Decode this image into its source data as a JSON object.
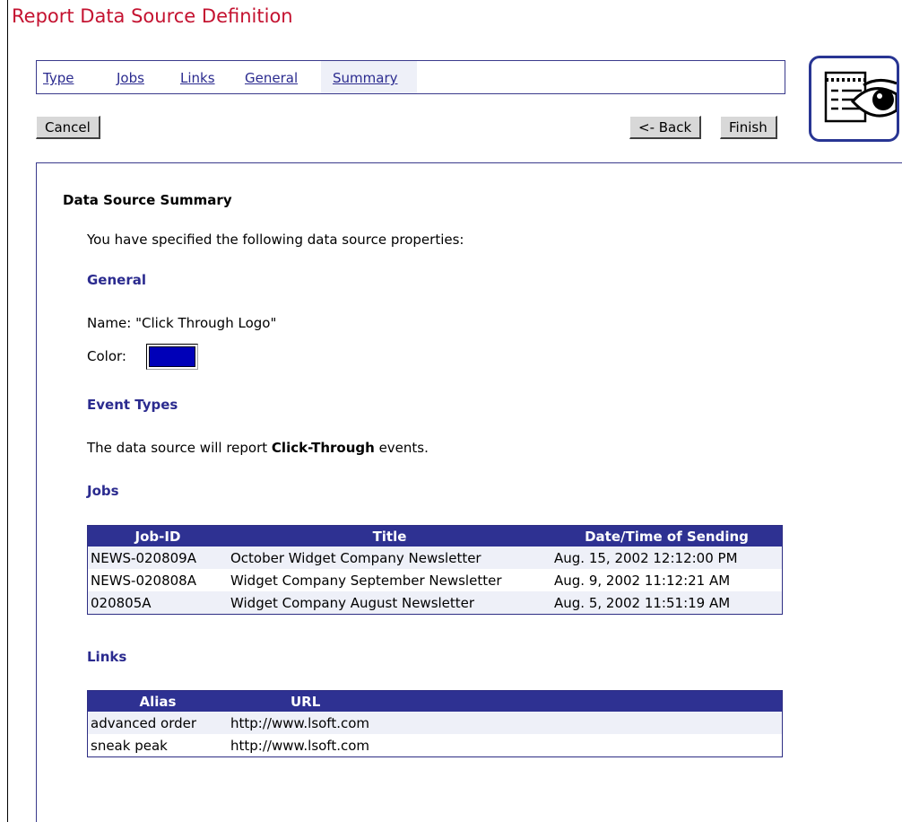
{
  "page": {
    "title": "Report Data Source Definition"
  },
  "tabs": [
    {
      "label": "Type"
    },
    {
      "label": "Jobs"
    },
    {
      "label": "Links"
    },
    {
      "label": "General"
    },
    {
      "label": "Summary",
      "active": true
    }
  ],
  "buttons": {
    "cancel": "Cancel",
    "back": "<- Back",
    "finish": "Finish"
  },
  "icon": "report-eye-icon",
  "summary": {
    "heading": "Data Source Summary",
    "intro": "You have specified the following data source properties:",
    "general": {
      "heading": "General",
      "name_line": "Name: \"Click Through Logo\"",
      "color_label": "Color:",
      "color_value": "#0000b8"
    },
    "event_types": {
      "heading": "Event Types",
      "text_before": "The data source will report ",
      "event_bold": "Click-Through",
      "text_after": " events."
    },
    "jobs": {
      "heading": "Jobs",
      "columns": [
        "Job-ID",
        "Title",
        "Date/Time of Sending"
      ],
      "rows": [
        [
          "NEWS-020809A",
          "October Widget Company Newsletter",
          "Aug. 15, 2002 12:12:00 PM"
        ],
        [
          "NEWS-020808A",
          "Widget Company September Newsletter",
          "Aug. 9, 2002 11:12:21 AM"
        ],
        [
          "020805A",
          "Widget Company August Newsletter",
          "Aug. 5, 2002 11:51:19 AM"
        ]
      ]
    },
    "links": {
      "heading": "Links",
      "columns": [
        "Alias",
        "URL"
      ],
      "rows": [
        [
          "advanced order",
          "http://www.lsoft.com"
        ],
        [
          "sneak peak",
          "http://www.lsoft.com"
        ]
      ]
    }
  },
  "colors": {
    "title": "#c41230",
    "accent": "#2b2b8f",
    "table_header": "#2e3192",
    "row_alt": "#eef0f8"
  }
}
